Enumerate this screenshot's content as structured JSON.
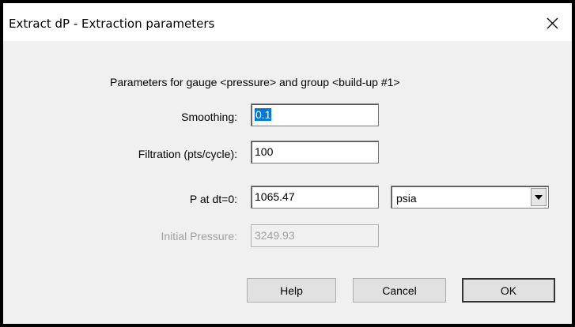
{
  "window": {
    "title": "Extract dP - Extraction parameters",
    "close_glyph": "✕"
  },
  "header_text": "Parameters for gauge <pressure> and group <build-up #1>",
  "fields": {
    "smoothing": {
      "label": "Smoothing:",
      "value": "0.1"
    },
    "filtration": {
      "label": "Filtration (pts/cycle):",
      "value": "100"
    },
    "p_at_dt0": {
      "label": "P at dt=0:",
      "value": "1065.47"
    },
    "initial_pressure": {
      "label": "Initial Pressure:",
      "value": "3249.93"
    }
  },
  "unit_select": {
    "selected": "psia",
    "icon": "chevron-down-icon"
  },
  "buttons": {
    "help": "Help",
    "cancel": "Cancel",
    "ok": "OK"
  },
  "colors": {
    "selection": "#0078d7",
    "dialog_bg": "#f0f0f0",
    "disabled_text": "#a0a0a0"
  }
}
